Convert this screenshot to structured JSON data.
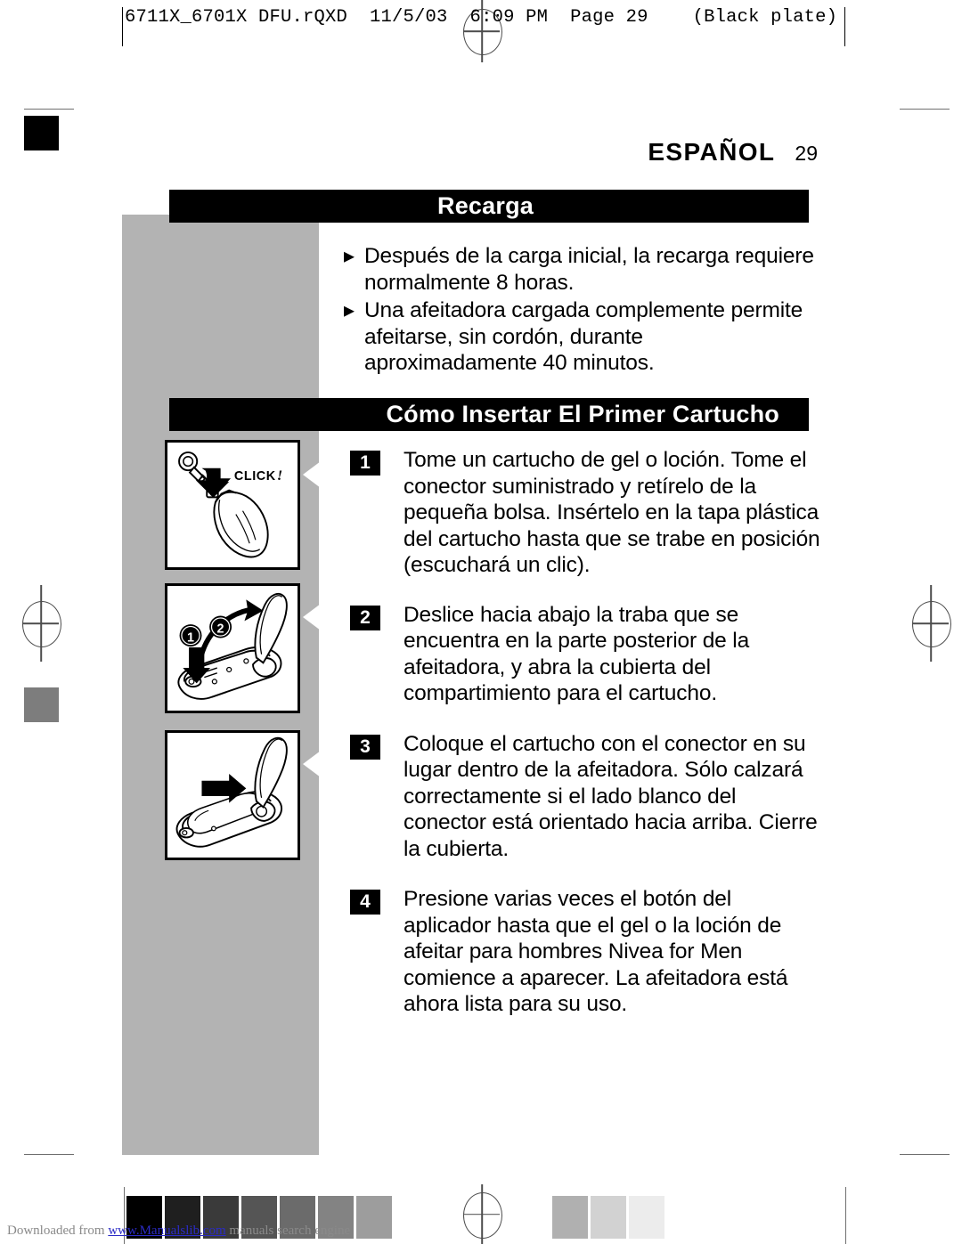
{
  "prepress": {
    "slug": "6711X_6701X DFU.rQXD  11/5/03  6:09 PM  Page 29    (Black plate)",
    "plate_note": "(Black plate)",
    "registration_color": "#4d4d4d",
    "trim_color": "#6f6f6f"
  },
  "page": {
    "language_label": "ESPAÑOL",
    "page_number": "29",
    "accent_bar_color": "#000000",
    "side_band_color": "#b3b3b3"
  },
  "sections": [
    {
      "title": "Recarga",
      "title_align": "center",
      "bullets": [
        {
          "glyph": "bullet-triangle",
          "text": "Después de la carga inicial, la recarga requiere normalmente 8 horas."
        },
        {
          "glyph": "bullet-triangle",
          "text": "Una afeitadora cargada complemente permite afeitarse, sin cordón, durante aproximadamente 40 minutos."
        }
      ]
    },
    {
      "title": "Cómo Insertar El Primer Cartucho",
      "title_align": "right",
      "steps": [
        {
          "number": "1",
          "text": "Tome un cartucho de gel o loción. Tome el conector suministrado y retírelo de la pequeña bolsa. Insértelo en la tapa plástica del cartucho hasta que se trabe en posición (escuchará un clic).",
          "figure": {
            "name": "connector-into-cartridge-cap",
            "caption": "CLICK !",
            "arrow": "arrow-down-left-black"
          }
        },
        {
          "number": "2",
          "text": "Deslice hacia abajo la traba que se encuentra en la parte posterior de la afeitadora, y abra la cubierta del compartimiento para el cartucho.",
          "figure": {
            "name": "shaver-open-cover",
            "callouts": [
              "1",
              "2"
            ],
            "arrow": "arrow-down-black"
          }
        },
        {
          "number": "3",
          "text": "Coloque el cartucho con el conector en su lugar dentro de la afeitadora. Sólo calzará correctamente si el lado blanco del conector está orientado hacia arriba. Cierre la cubierta.",
          "figure": {
            "name": "shaver-insert-cartridge",
            "arrow": "arrow-right-black"
          }
        },
        {
          "number": "4",
          "text": "Presione varias veces el botón del aplicador hasta que el gel o la loción de afeitar para hombres Nivea for Men comience a aparecer. La afeitadora está ahora lista para su uso.",
          "figure": null
        }
      ]
    }
  ],
  "color_wedge": {
    "dark_steps": [
      "#000000",
      "#1f1f1f",
      "#3a3a3a",
      "#555555",
      "#6b6b6b",
      "#838383",
      "#9d9d9d"
    ],
    "light_steps": [
      "#b0b0b0",
      "#d2d2d2",
      "#ececec"
    ]
  },
  "watermark": {
    "prefix": "Downloaded from ",
    "link": "www.Manualslib.com",
    "suffix": " manuals search engine",
    "link_color": "#2b2bc6"
  }
}
